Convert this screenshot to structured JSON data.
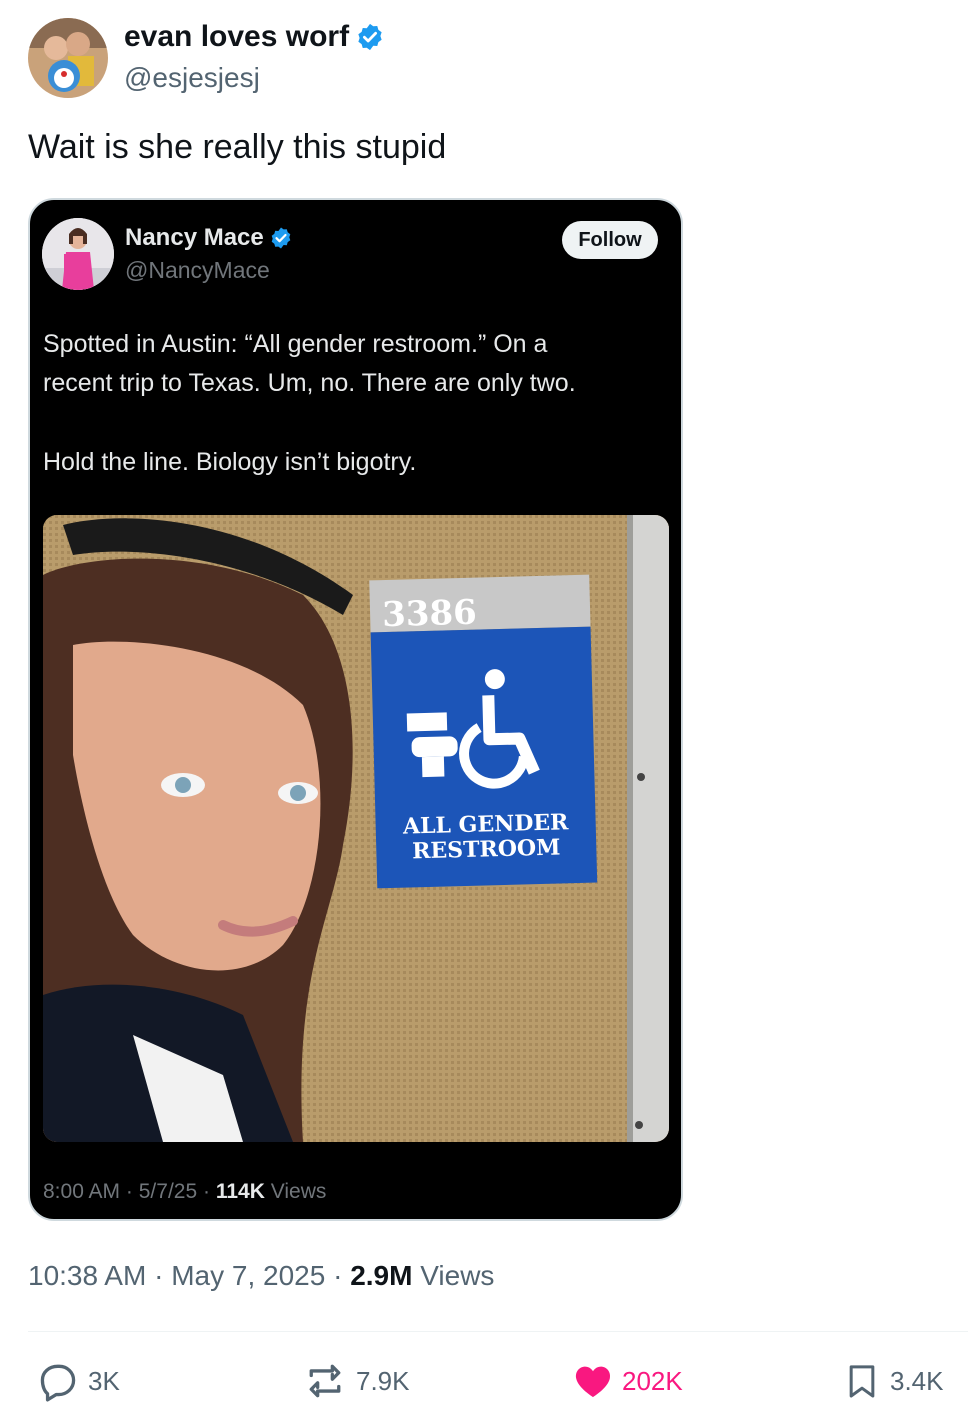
{
  "author": {
    "name": "evan loves worf",
    "handle": "@esjesjesj",
    "verified": true,
    "avatar_icon": "avatar-photo"
  },
  "tweet": {
    "text": "Wait is she really this stupid"
  },
  "quote": {
    "name": "Nancy Mace",
    "handle": "@NancyMace",
    "verified": true,
    "follow_label": "Follow",
    "text_line1": "Spotted in Austin: “All gender restroom.” On a",
    "text_line2": "recent trip to Texas. Um, no. There are only two.",
    "text_line3": "Hold the line. Biology isn’t bigotry.",
    "media": {
      "sign_number": "3386",
      "sign_line1": "ALL GENDER",
      "sign_line2": "RESTROOM"
    },
    "meta": {
      "time": "8:00 AM",
      "date": "5/7/25",
      "views_count": "114K",
      "views_label": "Views"
    }
  },
  "meta": {
    "time": "10:38 AM",
    "date": "May 7, 2025",
    "views_count": "2.9M",
    "views_label": "Views",
    "separator": "·"
  },
  "actions": {
    "replies": "3K",
    "reposts": "7.9K",
    "likes": "202K",
    "bookmarks": "3.4K"
  },
  "colors": {
    "verified": "#1d9bf0",
    "like": "#f91880",
    "muted": "#536471",
    "text": "#0f1419",
    "card_bg": "#000000"
  }
}
